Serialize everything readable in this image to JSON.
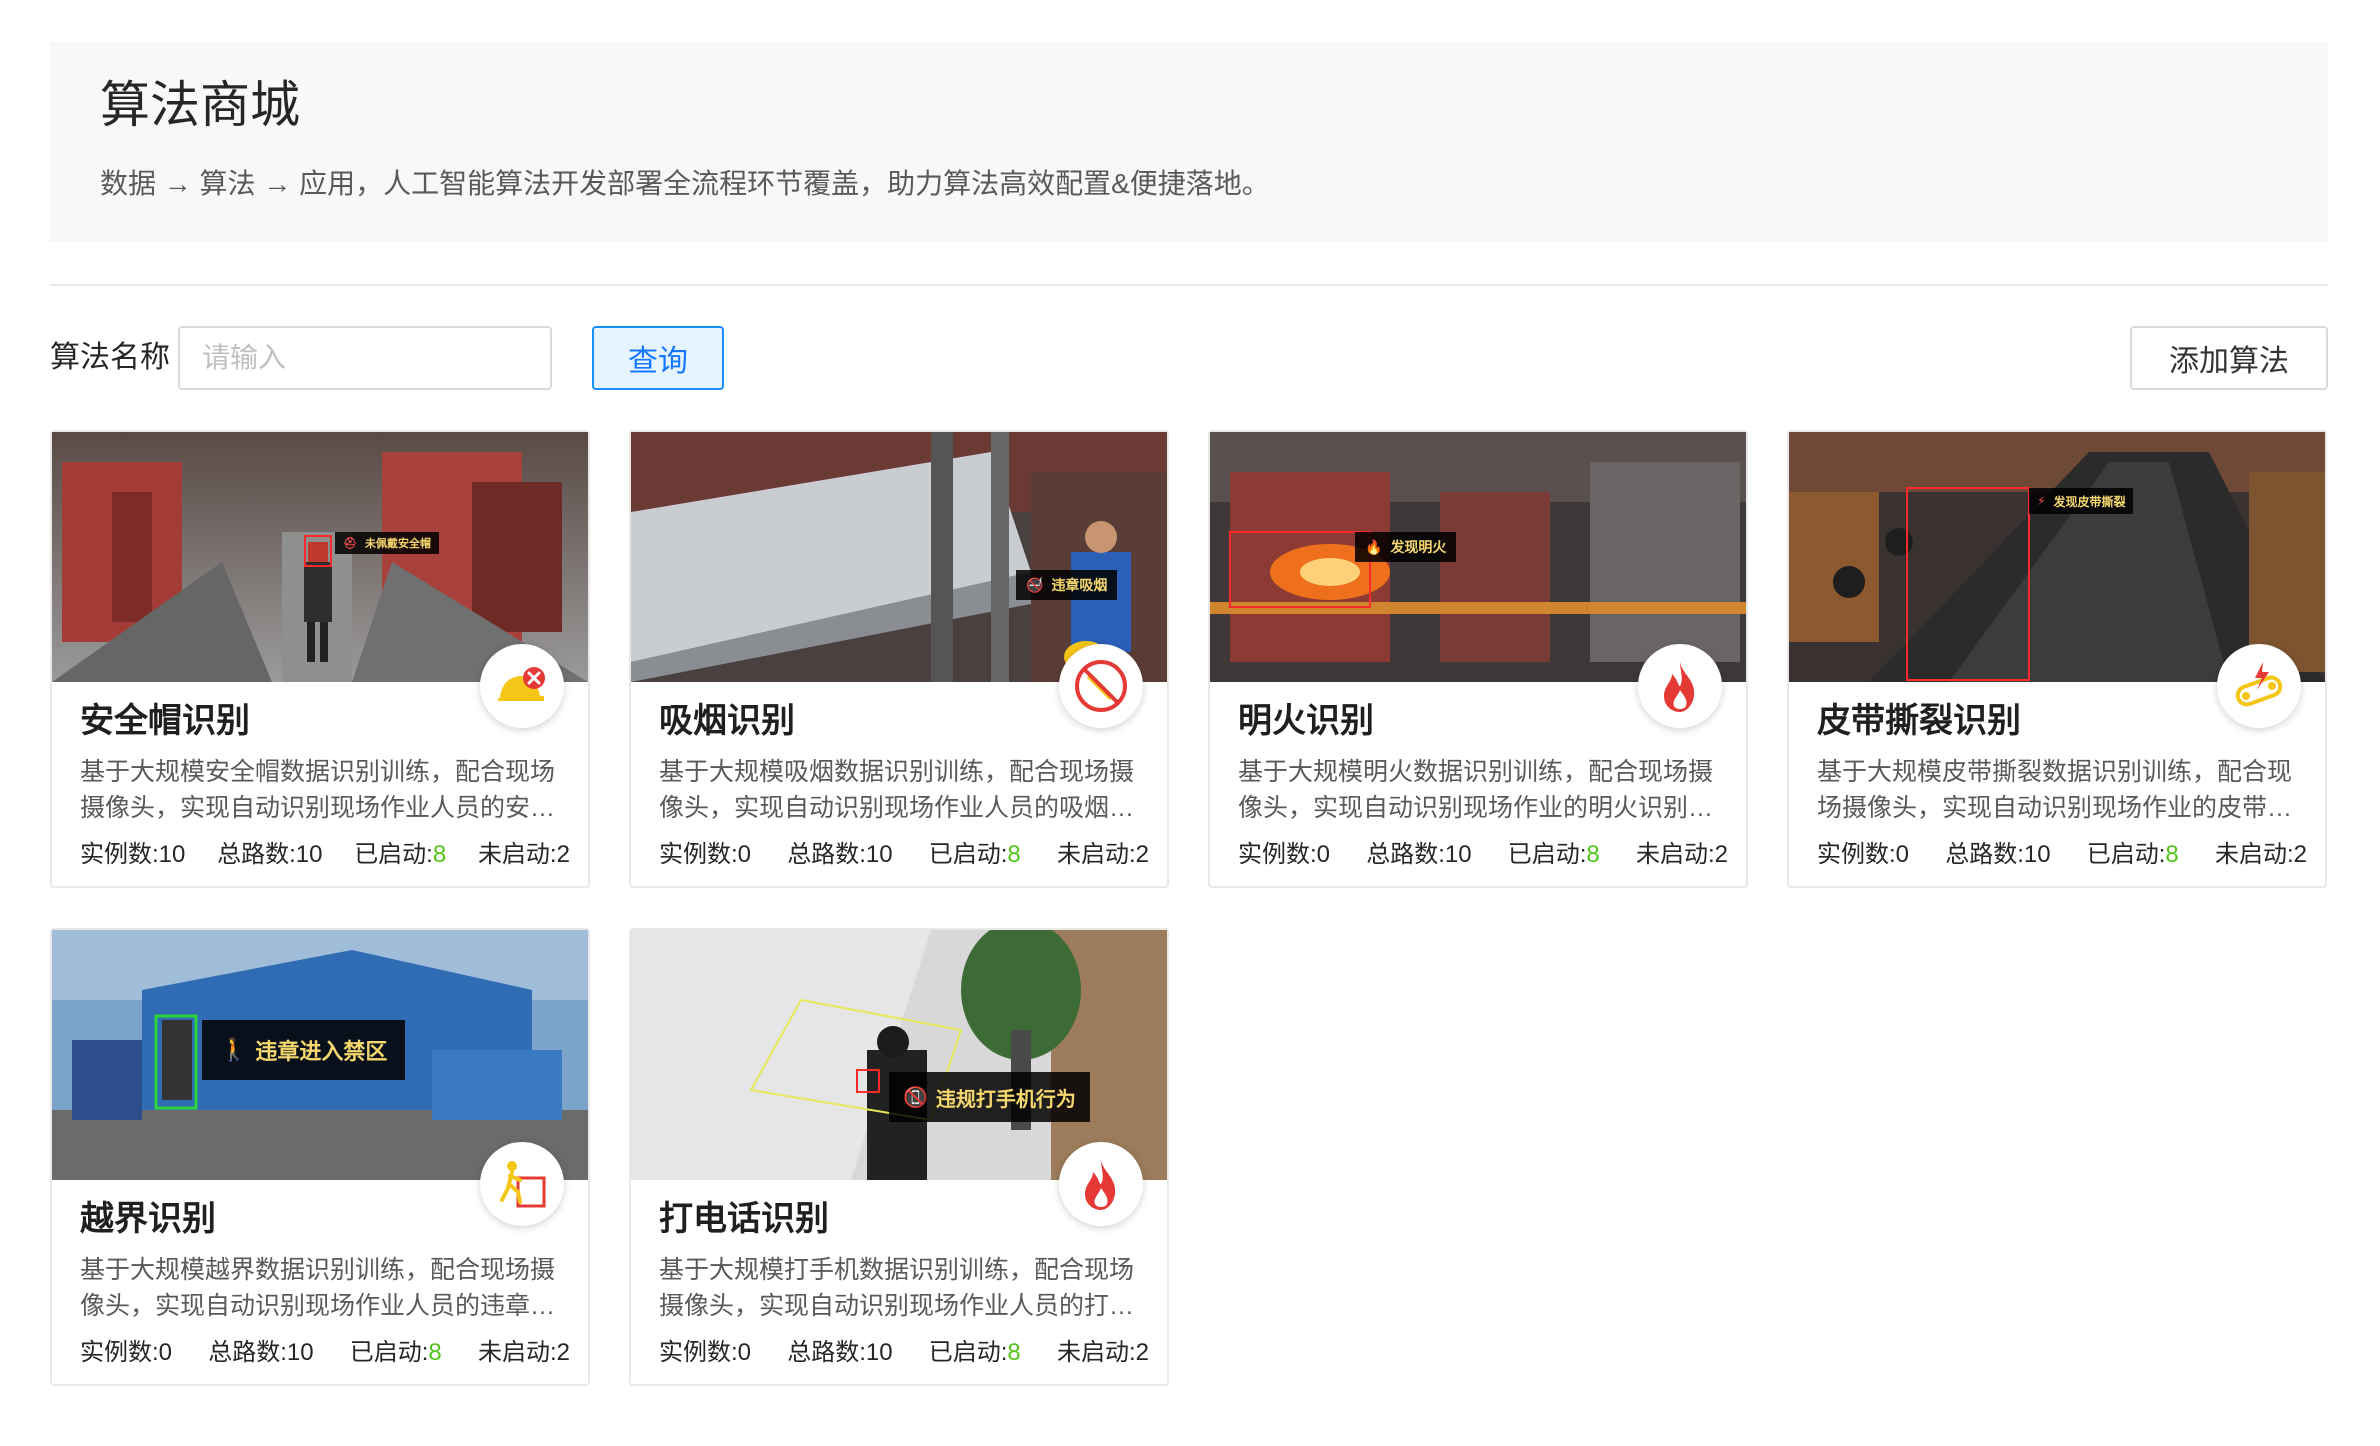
{
  "header": {
    "title": "算法商城",
    "subtitle": "数据 → 算法 → 应用，人工智能算法开发部署全流程环节覆盖，助力算法高效配置&便捷落地。"
  },
  "search": {
    "label": "算法名称",
    "placeholder": "请输入",
    "value": "",
    "query_label": "查询",
    "add_label": "添加算法"
  },
  "colors": {
    "primary": "#1677ff",
    "started": "#52c41a",
    "danger": "#e53935"
  },
  "stat_labels": {
    "instances": "实例数:",
    "total": "总路数:",
    "started": "已启动:",
    "stopped": "未启动:"
  },
  "cards": [
    {
      "title": "安全帽识别",
      "desc": "基于大规模安全帽数据识别训练，配合现场摄像头，实现自动识别现场作业人员的安全帽佩戴情况。",
      "instances": "10",
      "total": "10",
      "started": "8",
      "stopped": "2",
      "icon": "helmet-icon",
      "overlay": "未佩戴安全帽"
    },
    {
      "title": "吸烟识别",
      "desc": "基于大规模吸烟数据识别训练，配合现场摄像头，实现自动识别现场作业人员的吸烟违章行为。",
      "instances": "0",
      "total": "10",
      "started": "8",
      "stopped": "2",
      "icon": "no-smoking-icon",
      "overlay": "违章吸烟"
    },
    {
      "title": "明火识别",
      "desc": "基于大规模明火数据识别训练，配合现场摄像头，实现自动识别现场作业的明火识别，并及时告警。",
      "instances": "0",
      "total": "10",
      "started": "8",
      "stopped": "2",
      "icon": "fire-icon",
      "overlay": "发现明火"
    },
    {
      "title": "皮带撕裂识别",
      "desc": "基于大规模皮带撕裂数据识别训练，配合现场摄像头，实现自动识别现场作业的皮带撕裂情况。",
      "instances": "0",
      "total": "10",
      "started": "8",
      "stopped": "2",
      "icon": "belt-tear-icon",
      "overlay": "发现皮带撕裂"
    },
    {
      "title": "越界识别",
      "desc": "基于大规模越界数据识别训练，配合现场摄像头，实现自动识别现场作业人员的违章越界行为。",
      "instances": "0",
      "total": "10",
      "started": "8",
      "stopped": "2",
      "icon": "boundary-icon",
      "overlay": "违章进入禁区"
    },
    {
      "title": "打电话识别",
      "desc": "基于大规模打手机数据识别训练，配合现场摄像头，实现自动识别现场作业人员的打手机行为。",
      "instances": "0",
      "total": "10",
      "started": "8",
      "stopped": "2",
      "icon": "phone-fire-icon",
      "overlay": "违规打手机行为"
    }
  ]
}
